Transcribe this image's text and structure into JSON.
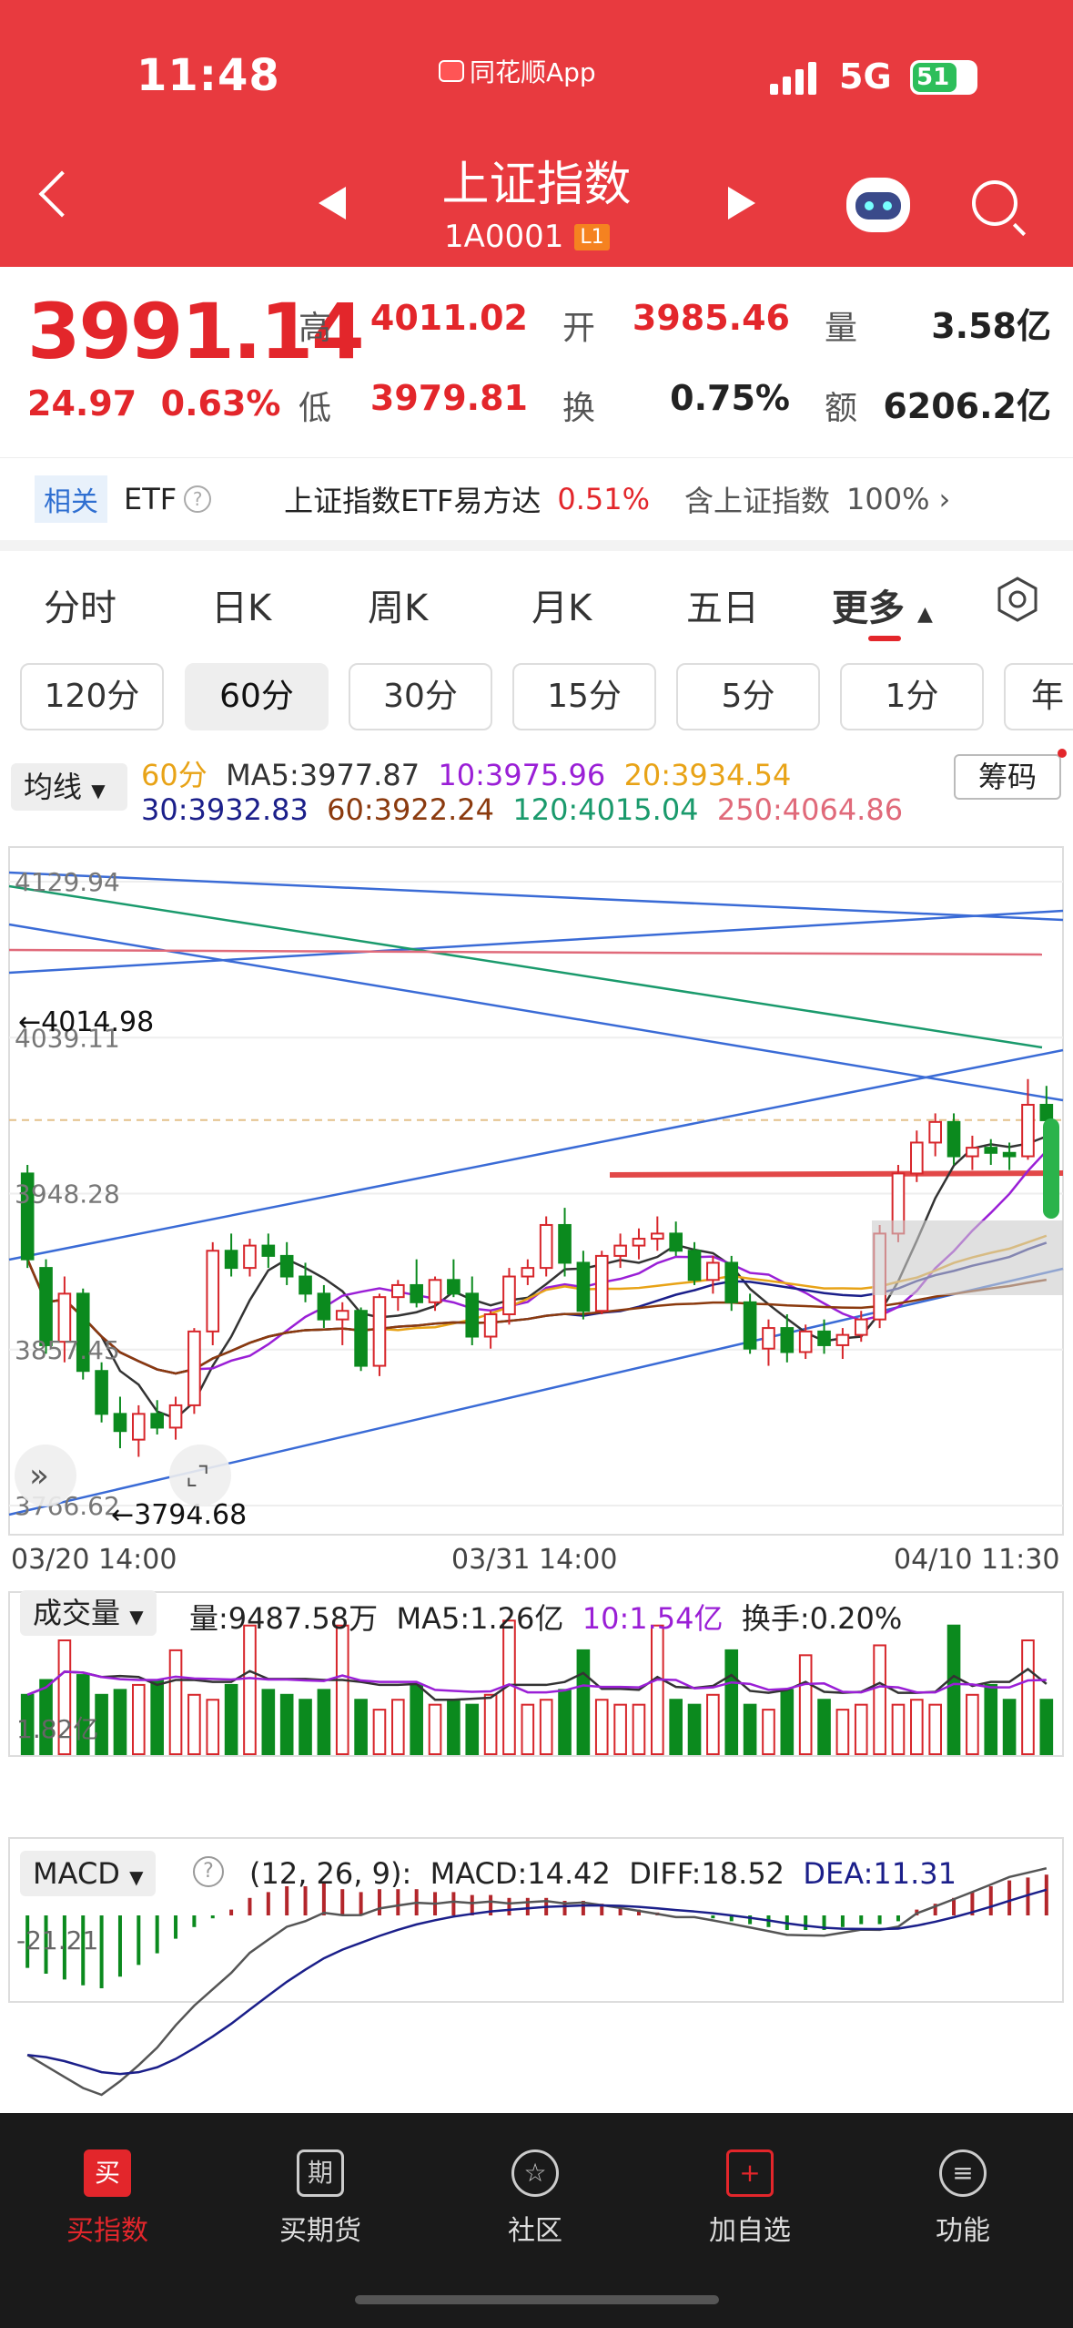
{
  "status": {
    "time": "11:48",
    "source_app": "同花顺App",
    "network": "5G",
    "battery": "51"
  },
  "header": {
    "title": "上证指数",
    "code": "1A0001",
    "level": "L1"
  },
  "quote": {
    "price": "3991.14",
    "change": "24.97",
    "change_pct": "0.63%",
    "high_label": "高",
    "high": "4011.02",
    "open_label": "开",
    "open": "3985.46",
    "vol_label": "量",
    "vol": "3.58亿",
    "low_label": "低",
    "low": "3979.81",
    "turnover_label": "换",
    "turnover": "0.75%",
    "amount_label": "额",
    "amount": "6206.2亿"
  },
  "etf": {
    "tag": "相关",
    "label": "ETF",
    "name": "上证指数ETF易方达",
    "pct": "0.51%",
    "holding": "含上证指数",
    "holding_pct": "100%"
  },
  "tabs": [
    "分时",
    "日K",
    "周K",
    "月K",
    "五日",
    "更多"
  ],
  "periods": [
    "120分",
    "60分",
    "30分",
    "15分",
    "5分",
    "1分",
    "年"
  ],
  "chart_header": {
    "mode": "均线",
    "chip": "筹码",
    "period": "60分",
    "ma5": "MA5:3977.87",
    "ma10": "10:3975.96",
    "ma20": "20:3934.54",
    "ma30": "30:3932.83",
    "ma60": "60:3922.24",
    "ma120": "120:4015.04",
    "ma250": "250:4064.86",
    "colors": {
      "ma5": "#333333",
      "ma10": "#9a1fd6",
      "ma20": "#e8a317",
      "ma30": "#1b1f8a",
      "ma60": "#8b3a0e",
      "ma120": "#1a9a6c",
      "ma250": "#e06a7a"
    }
  },
  "price_axis": [
    "4129.94",
    "4039.11",
    "3948.28",
    "3857.45",
    "3766.62"
  ],
  "markers": {
    "high": "←4014.98",
    "low": "←3794.68"
  },
  "time_axis": [
    "03/20 14:00",
    "03/31 14:00",
    "04/10 11:30"
  ],
  "volume_header": {
    "mode": "成交量",
    "vol": "量:9487.58万",
    "ma5": "MA5:1.26亿",
    "ma10": "10:1.54亿",
    "turnover": "换手:0.20%",
    "axis": "1.82亿"
  },
  "macd_header": {
    "mode": "MACD",
    "params": "(12, 26, 9):",
    "macd": "MACD:14.42",
    "diff": "DIFF:18.52",
    "dea": "DEA:11.31",
    "axis": "-21.21"
  },
  "chart_data": {
    "type": "candlestick",
    "interval": "60分",
    "ylim": [
      3766.62,
      4129.94
    ],
    "candles": [
      [
        3960,
        3965,
        3905,
        3910
      ],
      [
        3905,
        3910,
        3855,
        3860
      ],
      [
        3862,
        3900,
        3850,
        3890
      ],
      [
        3890,
        3893,
        3840,
        3845
      ],
      [
        3845,
        3850,
        3815,
        3820
      ],
      [
        3820,
        3830,
        3800,
        3810
      ],
      [
        3805,
        3825,
        3795,
        3820
      ],
      [
        3820,
        3828,
        3808,
        3812
      ],
      [
        3812,
        3830,
        3805,
        3825
      ],
      [
        3825,
        3870,
        3820,
        3868
      ],
      [
        3868,
        3920,
        3860,
        3915
      ],
      [
        3915,
        3925,
        3900,
        3905
      ],
      [
        3905,
        3922,
        3900,
        3918
      ],
      [
        3918,
        3925,
        3905,
        3912
      ],
      [
        3912,
        3920,
        3895,
        3900
      ],
      [
        3900,
        3908,
        3885,
        3890
      ],
      [
        3890,
        3895,
        3870,
        3875
      ],
      [
        3875,
        3885,
        3860,
        3880
      ],
      [
        3880,
        3882,
        3845,
        3848
      ],
      [
        3848,
        3890,
        3842,
        3888
      ],
      [
        3888,
        3898,
        3880,
        3895
      ],
      [
        3895,
        3910,
        3882,
        3885
      ],
      [
        3885,
        3900,
        3880,
        3898
      ],
      [
        3898,
        3910,
        3888,
        3890
      ],
      [
        3890,
        3900,
        3860,
        3865
      ],
      [
        3865,
        3880,
        3858,
        3878
      ],
      [
        3878,
        3905,
        3872,
        3900
      ],
      [
        3900,
        3910,
        3895,
        3905
      ],
      [
        3905,
        3935,
        3900,
        3930
      ],
      [
        3930,
        3940,
        3900,
        3908
      ],
      [
        3908,
        3915,
        3875,
        3880
      ],
      [
        3880,
        3915,
        3878,
        3912
      ],
      [
        3912,
        3925,
        3905,
        3918
      ],
      [
        3918,
        3928,
        3910,
        3922
      ],
      [
        3922,
        3935,
        3915,
        3925
      ],
      [
        3925,
        3932,
        3912,
        3915
      ],
      [
        3915,
        3920,
        3895,
        3898
      ],
      [
        3898,
        3912,
        3890,
        3908
      ],
      [
        3908,
        3912,
        3880,
        3885
      ],
      [
        3885,
        3890,
        3855,
        3858
      ],
      [
        3858,
        3875,
        3848,
        3870
      ],
      [
        3870,
        3878,
        3850,
        3856
      ],
      [
        3856,
        3872,
        3852,
        3868
      ],
      [
        3868,
        3875,
        3855,
        3860
      ],
      [
        3860,
        3870,
        3852,
        3866
      ],
      [
        3866,
        3880,
        3862,
        3875
      ],
      [
        3875,
        3930,
        3870,
        3925
      ],
      [
        3925,
        3965,
        3920,
        3960
      ],
      [
        3960,
        3985,
        3955,
        3978
      ],
      [
        3978,
        3995,
        3970,
        3990
      ],
      [
        3990,
        3995,
        3965,
        3970
      ],
      [
        3970,
        3982,
        3962,
        3975
      ],
      [
        3975,
        3980,
        3965,
        3972
      ],
      [
        3972,
        3978,
        3962,
        3970
      ],
      [
        3970,
        4015,
        3968,
        4000
      ],
      [
        4000,
        4011,
        3980,
        3991
      ]
    ],
    "volume_unit": "亿",
    "volume": [
      1.2,
      1.5,
      2.3,
      1.6,
      1.2,
      1.3,
      1.4,
      1.5,
      2.1,
      1.2,
      1.1,
      1.4,
      2.6,
      1.3,
      1.2,
      1.1,
      1.3,
      2.6,
      1.1,
      0.9,
      1.1,
      1.4,
      1.0,
      1.1,
      1.0,
      1.2,
      2.7,
      1.0,
      1.1,
      1.3,
      2.1,
      1.1,
      1.0,
      1.0,
      2.6,
      1.1,
      1.0,
      1.2,
      2.1,
      1.0,
      0.9,
      1.3,
      2.0,
      1.1,
      0.9,
      1.0,
      2.2,
      1.0,
      1.1,
      1.0,
      2.6,
      1.2,
      1.4,
      1.1,
      2.3,
      1.1
    ],
    "macd": [
      -18,
      -20,
      -22,
      -24,
      -25,
      -21,
      -17,
      -13,
      -8,
      -4,
      -1,
      2,
      6,
      8,
      10,
      10,
      11,
      9,
      8,
      9,
      9,
      9,
      8,
      8,
      7,
      7,
      6,
      6,
      6,
      5,
      5,
      4,
      3,
      2,
      1,
      0,
      0,
      -1,
      -2,
      -3,
      -4,
      -5,
      -5,
      -5,
      -4,
      -3,
      -3,
      -2,
      2,
      4,
      6,
      8,
      10,
      12,
      13,
      14
    ]
  }
}
